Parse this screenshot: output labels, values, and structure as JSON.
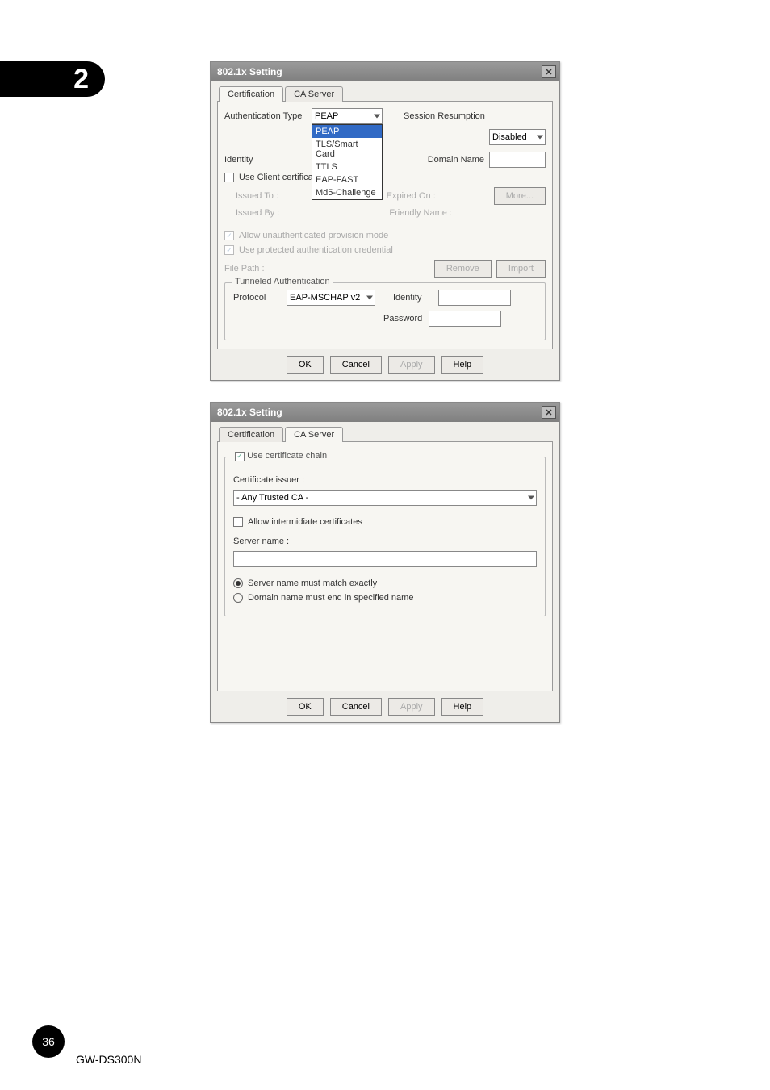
{
  "chapter": "2",
  "dialog1": {
    "title": "802.1x Setting",
    "tabs": {
      "cert": "Certification",
      "ca": "CA Server"
    },
    "authTypeLabel": "Authentication Type",
    "authTypeValue": "PEAP",
    "authTypeOptions": [
      "PEAP",
      "TLS/Smart Card",
      "TTLS",
      "EAP-FAST",
      "Md5-Challenge"
    ],
    "sessionLabel": "Session Resumption",
    "sessionValue": "Disabled",
    "identityLabel": "Identity",
    "domainLabel": "Domain Name",
    "useClientCert": "Use Client certificate",
    "issuedTo": "Issued To :",
    "issuedBy": "Issued By :",
    "expiredOn": "Expired On :",
    "friendlyName": "Friendly Name :",
    "moreBtn": "More...",
    "allowUnauth": "Allow unauthenticated provision mode",
    "useProtected": "Use protected authentication credential",
    "filePath": "File Path :",
    "removeBtn": "Remove",
    "importBtn": "Import",
    "tunneledLegend": "Tunneled Authentication",
    "protocolLabel": "Protocol",
    "protocolValue": "EAP-MSCHAP v2",
    "identity2": "Identity",
    "password": "Password",
    "ok": "OK",
    "cancel": "Cancel",
    "apply": "Apply",
    "help": "Help"
  },
  "dialog2": {
    "title": "802.1x Setting",
    "tabs": {
      "cert": "Certification",
      "ca": "CA Server"
    },
    "useCertChain": "Use certificate chain",
    "certIssuer": "Certificate issuer :",
    "issuerValue": "- Any Trusted CA -",
    "allowIntermediate": "Allow intermidiate certificates",
    "serverName": "Server name :",
    "matchExactly": "Server name must match exactly",
    "domainEnd": "Domain name must end in specified name",
    "ok": "OK",
    "cancel": "Cancel",
    "apply": "Apply",
    "help": "Help"
  },
  "page": "36",
  "model": "GW-DS300N"
}
